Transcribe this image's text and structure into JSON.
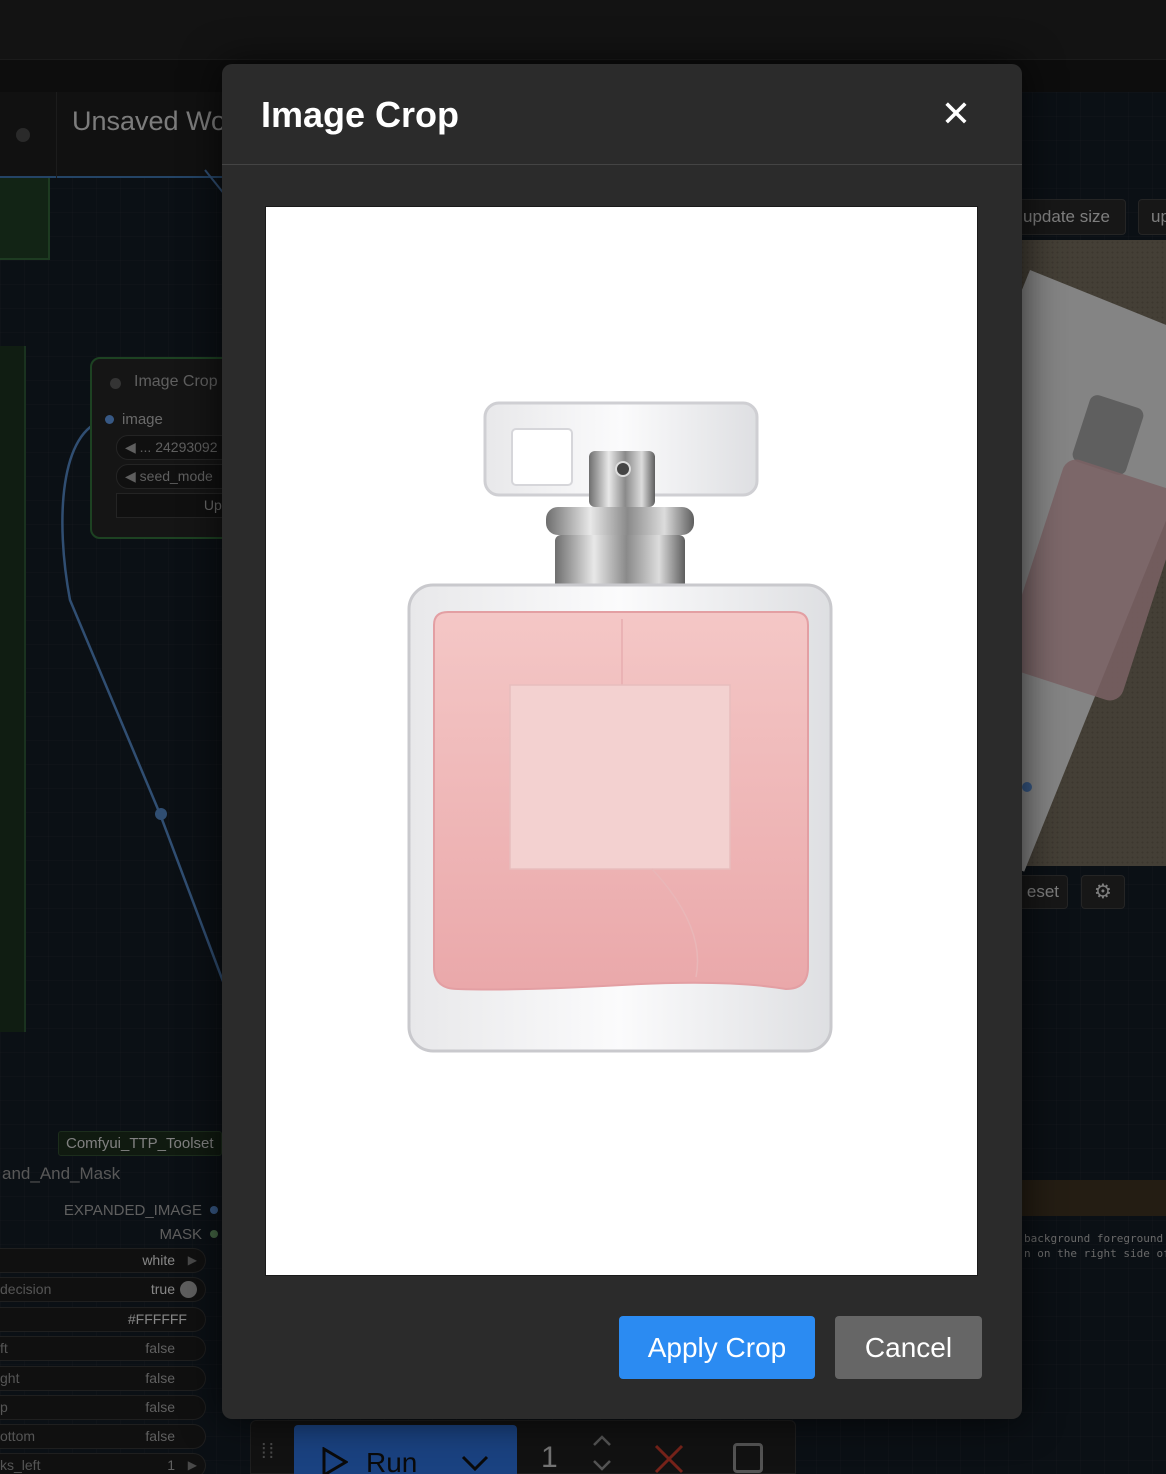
{
  "background": {
    "workflow_tab": {
      "title": "Unsaved Workflow"
    },
    "node": {
      "title": "Image Crop",
      "input_label": "image",
      "seed_widget": "◀ ... 24293092",
      "seed_mode_widget": "◀ seed_mode",
      "update_button": "Update"
    },
    "toolset_tag": "Comfyui_TTP_Toolset",
    "node2": {
      "title": "and_And_Mask",
      "outputs": [
        "EXPANDED_IMAGE",
        "MASK"
      ],
      "rows": [
        {
          "label": "",
          "value": "white"
        },
        {
          "label": "decision",
          "value": "true"
        },
        {
          "label": "",
          "value": "#FFFFFF"
        },
        {
          "label": "ft",
          "value": "false"
        },
        {
          "label": "ght",
          "value": "false"
        },
        {
          "label": "p",
          "value": "false"
        },
        {
          "label": "ottom",
          "value": "false"
        },
        {
          "label": "ks_left",
          "value": "1"
        }
      ]
    },
    "right_panel": {
      "update_size_button": "update size",
      "update_button_2": "up",
      "reset_button": "eset",
      "settings_icon": "gear-icon",
      "log_line_1": "background foreground i",
      "log_line_2": "n on the right side of"
    },
    "runbar": {
      "run_label": "Run",
      "batch_count": "1"
    }
  },
  "modal": {
    "title": "Image Crop",
    "close_label": "✕",
    "apply_label": "Apply Crop",
    "cancel_label": "Cancel"
  },
  "colors": {
    "accent": "#2b8bf2",
    "cancel": "#666666",
    "modal_bg": "#2b2b2b"
  }
}
